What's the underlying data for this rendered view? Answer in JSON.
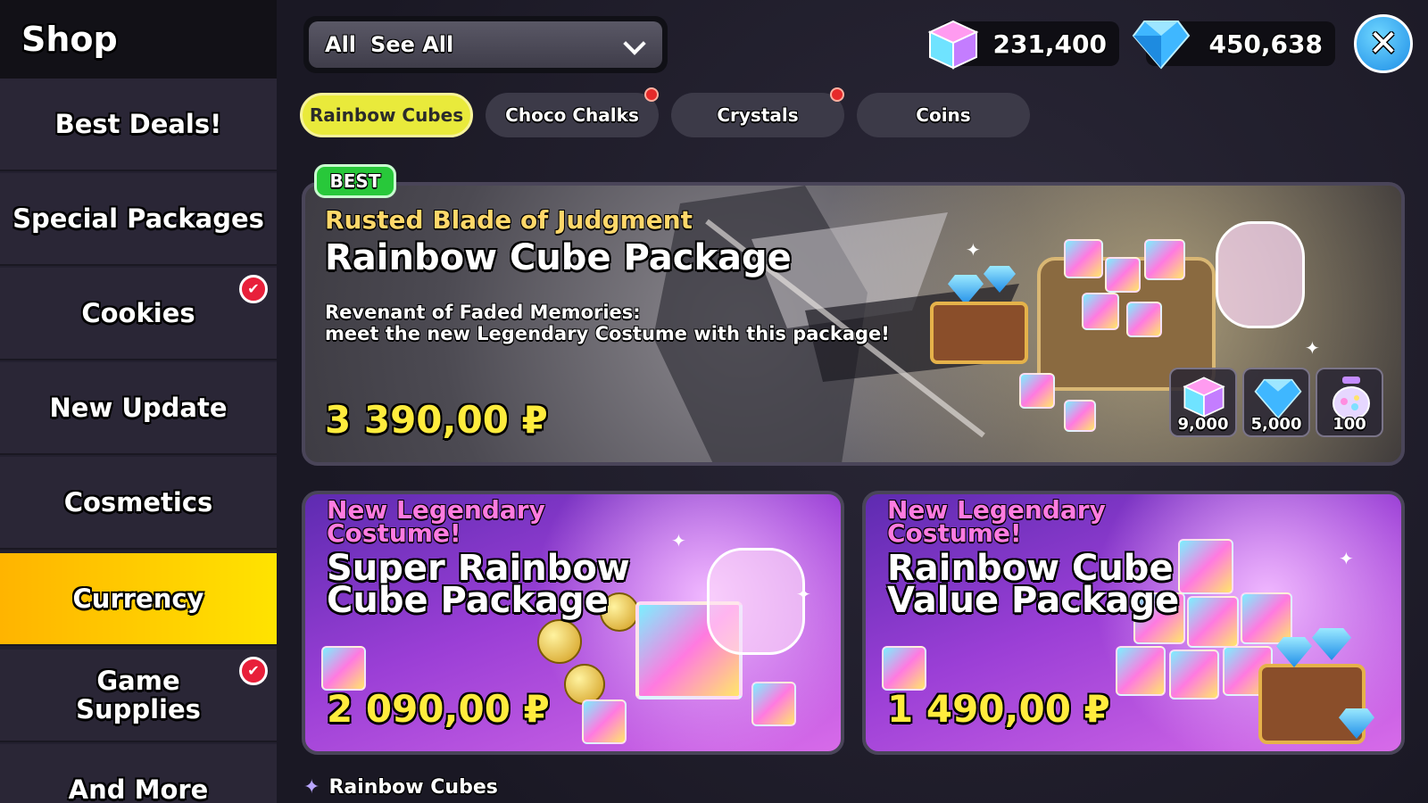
{
  "sidebar": {
    "title": "Shop",
    "items": [
      {
        "label": "Best Deals!"
      },
      {
        "label": "Special Packages"
      },
      {
        "label": "Cookies",
        "badge": "✔"
      },
      {
        "label": "New Update"
      },
      {
        "label": "Cosmetics"
      },
      {
        "label": "Currency",
        "active": true
      },
      {
        "label": "Game Supplies",
        "badge": "✔"
      },
      {
        "label": "And More"
      }
    ]
  },
  "filter": {
    "all_label": "All",
    "value": "See All"
  },
  "currencies": [
    {
      "icon": "rainbow-cube-icon",
      "amount": "231,400"
    },
    {
      "icon": "crystal-icon",
      "amount": "450,638"
    }
  ],
  "close_label": "✕",
  "tabs": [
    {
      "label": "Rainbow Cubes",
      "active": true
    },
    {
      "label": "Choco Chalks",
      "notify": true
    },
    {
      "label": "Crystals",
      "notify": true
    },
    {
      "label": "Coins"
    }
  ],
  "featured": {
    "badge": "BEST",
    "subtitle": "Rusted Blade of Judgment",
    "title": "Rainbow Cube Package",
    "desc_line1": "Revenant of Faded Memories:",
    "desc_line2": "meet the new Legendary Costume with this package!",
    "price": "3 390,00 ₽",
    "rewards": [
      {
        "icon": "rainbow-cube-icon",
        "value": "9,000"
      },
      {
        "icon": "crystal-icon",
        "value": "5,000"
      },
      {
        "icon": "jar-icon",
        "value": "100"
      }
    ]
  },
  "cards": [
    {
      "subtitle_l1": "New Legendary",
      "subtitle_l2": "Costume!",
      "title_l1": "Super Rainbow",
      "title_l2": "Cube Package",
      "price": "2 090,00 ₽"
    },
    {
      "subtitle_l1": "New Legendary",
      "subtitle_l2": "Costume!",
      "title_l1": "Rainbow Cube",
      "title_l2": "Value Package",
      "price": "1 490,00 ₽"
    }
  ],
  "section_label": "Rainbow Cubes"
}
